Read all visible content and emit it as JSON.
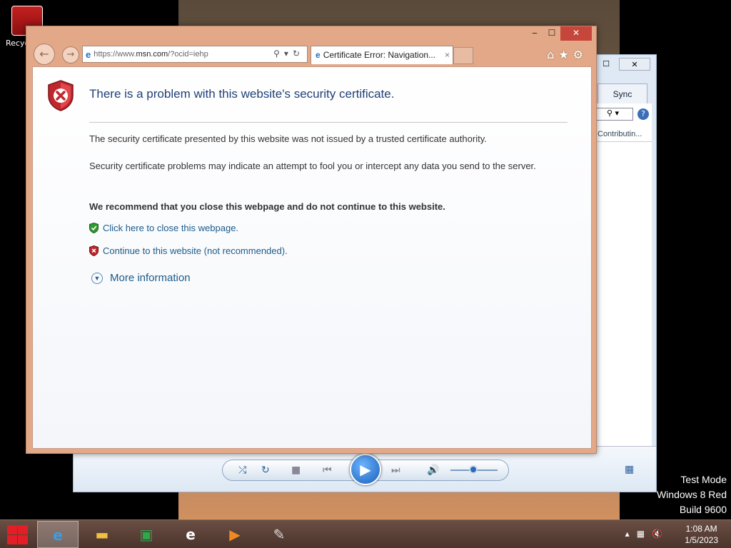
{
  "desktop": {
    "recycle_bin_label": "Recyc",
    "watermark": [
      "Test Mode",
      "Windows 8 Red",
      "Build 9600"
    ]
  },
  "media_player": {
    "tab_sync": "Sync",
    "column_header": "Contributin...",
    "help": "?"
  },
  "browser": {
    "address": {
      "prefix": "https://www.",
      "domain": "msn.com",
      "suffix": "/?ocid=iehp"
    },
    "tab_title": "Certificate Error: Navigation...",
    "tab_close": "×"
  },
  "page": {
    "heading": "There is a problem with this website's security certificate.",
    "paragraph1": "The security certificate presented by this website was not issued by a trusted certificate authority.",
    "paragraph2": "Security certificate problems may indicate an attempt to fool you or intercept any data you send to the server.",
    "recommendation": "We recommend that you close this webpage and do not continue to this website.",
    "close_link": "Click here to close this webpage.",
    "continue_link": "Continue to this website (not recommended).",
    "more_info": "More information"
  },
  "taskbar": {
    "time": "1:08 AM",
    "date": "1/5/2023"
  },
  "colors": {
    "ie_frame": "#e2a888",
    "heading": "#1f3f78",
    "link": "#1a5a8a",
    "close_button": "#c7463b"
  }
}
